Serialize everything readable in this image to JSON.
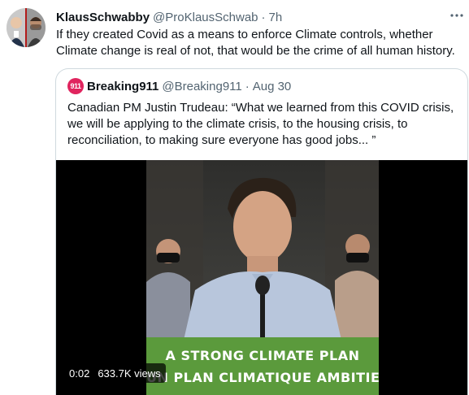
{
  "tweet": {
    "author_name": "KlausSchwabby",
    "author_handle": "@ProKlausSchwab",
    "separator": "·",
    "time": "7h",
    "text": "If they created Covid as a means to enforce Climate controls, whether Climate change is real of not, that would be the crime of all human history.",
    "avatar_icon": "avatar-composite-photo",
    "more_icon": "more-horizontal-icon"
  },
  "quoted": {
    "avatar_label": "911",
    "avatar_color": "#e0245e",
    "author_name": "Breaking911",
    "author_handle": "@Breaking911",
    "separator": "·",
    "date": "Aug 30",
    "text": "Canadian PM Justin Trudeau: “What we learned from this COVID crisis, we will be applying to the climate crisis, to the housing crisis, to reconciliation, to making sure everyone has good jobs... ”",
    "video": {
      "banner_line_1": "A STRONG CLIMATE PLAN",
      "banner_line_2": "UN PLAN CLIMATIQUE AMBITIEUX",
      "banner_color": "#5b9a3c",
      "duration": "0:02",
      "views": "633.7K views"
    }
  },
  "colors": {
    "text_primary": "#0f1419",
    "text_secondary": "#536471",
    "border": "#cfd9de"
  }
}
